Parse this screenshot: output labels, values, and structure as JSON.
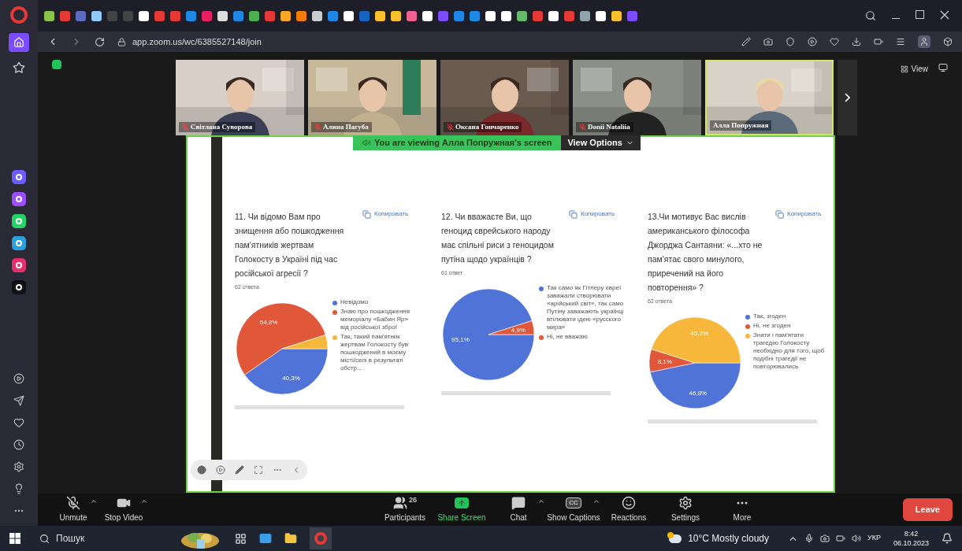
{
  "browser": {
    "url": "app.zoom.us/wc/6385527148/join"
  },
  "participants": [
    {
      "name": "Світлана Суворова",
      "muted": true,
      "selected": false
    },
    {
      "name": "Алина Пагуба",
      "muted": true,
      "selected": false
    },
    {
      "name": "Оксана Гончаренко",
      "muted": true,
      "selected": false
    },
    {
      "name": "Donii Nataliia",
      "muted": true,
      "selected": false
    },
    {
      "name": "Алла Попружная",
      "muted": false,
      "selected": true
    }
  ],
  "view_button": "View",
  "share_banner": {
    "text": "You are viewing Алла Попружная's screen",
    "button": "View Options"
  },
  "questions": [
    {
      "title": "11. Чи відомо Вам про знищення або пошкодження пам'ятників жертвам Голокосту в Україні під час російської агресії ?",
      "copy_label": "Копировать",
      "count": "62 ответа",
      "legend": [
        {
          "color": "#4f73d6"
        },
        {
          "color": "#e0573a"
        },
        {
          "color": "#f7b73a"
        }
      ],
      "chart_data": {
        "type": "pie",
        "categories": [
          "Невідомо",
          "Знаю про пошкодження меморіалу «Бабин Яр» від російської зброї",
          "Так, такий пам'ятник жертвам Голокосту був пошкоджений в моєму місті/селі в результаті обстр..."
        ],
        "values": [
          40.3,
          54.8,
          4.9
        ],
        "value_labels": [
          "40,3%",
          "54,8%",
          null
        ]
      }
    },
    {
      "title": "12. Чи вважаєте Ви, що геноцид єврейського народу має спільні риси з геноцидом путіна щодо українців ?",
      "copy_label": "Копировать",
      "count": "61 ответ",
      "legend": [
        {
          "color": "#4f73d6"
        },
        {
          "color": "#e0573a"
        }
      ],
      "chart_data": {
        "type": "pie",
        "categories": [
          "Так само як Гітлеру євреї заважали створювати «арійський світ», так само Путіну заважають українці втілювати ідею «русского мира»",
          "Ні, не вважаю"
        ],
        "values": [
          95.1,
          4.9
        ],
        "value_labels": [
          "95,1%",
          "4,9%"
        ]
      }
    },
    {
      "title": "13.Чи мотивує Вас вислів американського філософа Джорджа Сантаяни: «...хто не пам'ятає свого минулого, приречений на його повторення» ?",
      "copy_label": "Копировать",
      "count": "62 ответа",
      "legend": [
        {
          "color": "#4f73d6"
        },
        {
          "color": "#e0573a"
        },
        {
          "color": "#f7b73a"
        }
      ],
      "chart_data": {
        "type": "pie",
        "categories": [
          "Так, згоден",
          "Ні, не згоден",
          "Знати і пам'ятати трагедію Голокосту необхідно для того, щоб подібні трагедії не повторювались"
        ],
        "values": [
          46.8,
          8.1,
          45.2
        ],
        "value_labels": [
          "46,8%",
          "8,1%",
          "45,2%"
        ]
      }
    }
  ],
  "toolbar": [
    {
      "kind": "mute",
      "label": "Unmute",
      "caret": true
    },
    {
      "kind": "video",
      "label": "Stop Video",
      "caret": true
    },
    {
      "kind": "participants",
      "label": "Participants",
      "caret": false,
      "badge": "26"
    },
    {
      "kind": "share",
      "label": "Share Screen",
      "caret": false
    },
    {
      "kind": "chat",
      "label": "Chat",
      "caret": true
    },
    {
      "kind": "captions",
      "label": "Show Captions",
      "caret": true,
      "icon_text": "CC"
    },
    {
      "kind": "reactions",
      "label": "Reactions",
      "caret": false
    },
    {
      "kind": "settings",
      "label": "Settings",
      "caret": false
    },
    {
      "kind": "more",
      "label": "More",
      "caret": false
    }
  ],
  "leave_button": "Leave",
  "taskbar": {
    "search_placeholder": "Пошук",
    "weather": "10°C Mostly cloudy",
    "language": "УКР",
    "time": "8:42",
    "date": "06.10.2023"
  }
}
